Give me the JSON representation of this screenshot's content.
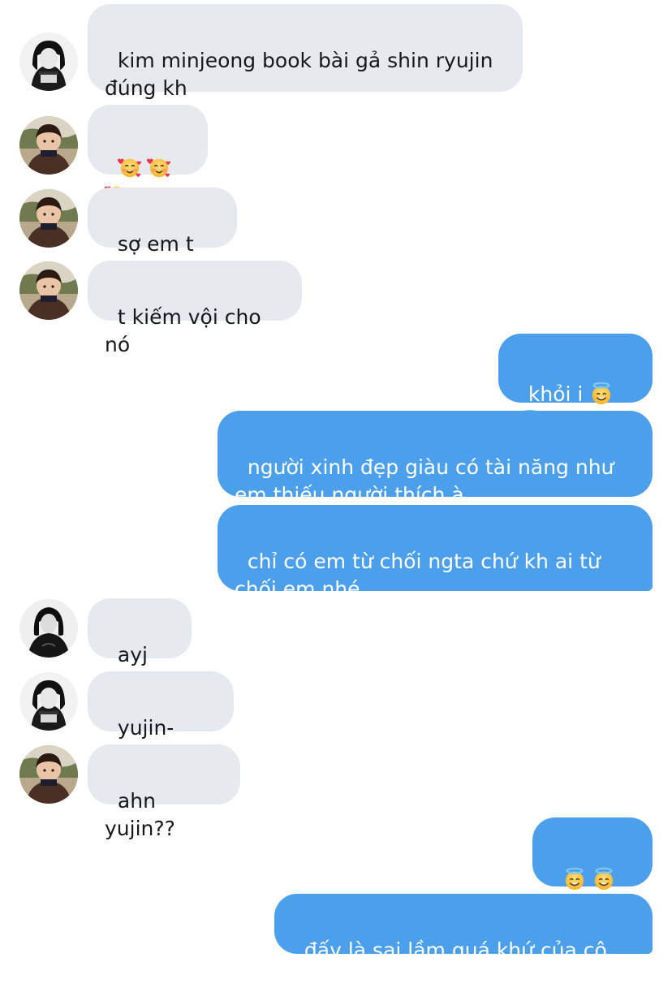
{
  "conversation": {
    "messages": [
      {
        "side": "in",
        "avatar": "bw-girl",
        "text": "kim minjeong book bài gả shin ryujin\nđúng kh"
      },
      {
        "side": "in",
        "avatar": "child",
        "text": "",
        "emoji": [
          "smiling-face-with-hearts-icon",
          "smiling-face-with-hearts-icon",
          "smiling-face-with-hearts-icon"
        ]
      },
      {
        "side": "in",
        "avatar": "child",
        "text": "sợ em t luỵ"
      },
      {
        "side": "in",
        "avatar": "child",
        "text": "t kiếm vội cho nó"
      },
      {
        "side": "out",
        "text": "khỏi i",
        "emoji": [
          "smiling-face-with-halo-icon",
          "smiling-face-with-halo-icon"
        ]
      },
      {
        "side": "out",
        "text": "người xinh đẹp giàu có tài năng như\nem thiếu người thích à"
      },
      {
        "side": "out",
        "text": "chỉ có em từ chối ngta chứ kh ai từ\nchối em nhé"
      },
      {
        "side": "in",
        "avatar": "bw-woman",
        "text": "ayj ???"
      },
      {
        "side": "in",
        "avatar": "bw-girl",
        "text": "yujin-ssi??"
      },
      {
        "side": "in",
        "avatar": "child",
        "text": "ahn yujin??"
      },
      {
        "side": "out",
        "text": "",
        "emoji": [
          "smiling-face-with-halo-icon",
          "smiling-face-with-halo-icon",
          "smiling-face-with-halo-icon"
        ]
      },
      {
        "side": "out",
        "text": "đấy là sai lầm quá khứ của cô ấy"
      }
    ]
  },
  "colors": {
    "incoming_bubble": "#e6e9ee",
    "outgoing_bubble": "#4c9fea",
    "incoming_text": "#16181c",
    "outgoing_text": "#ffffff"
  }
}
